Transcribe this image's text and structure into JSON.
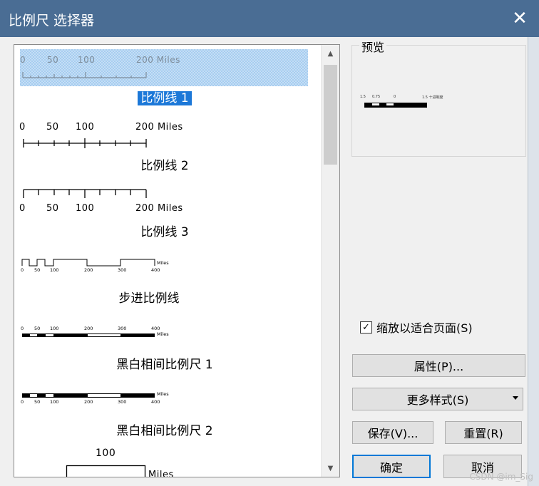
{
  "window": {
    "title": "比例尺 选择器",
    "close_glyph": "✕"
  },
  "list": {
    "items": [
      {
        "label": "比例线 1",
        "selected": true,
        "ticks": [
          "0",
          "50",
          "100",
          "200 Miles"
        ]
      },
      {
        "label": "比例线 2",
        "ticks": [
          "0",
          "50",
          "100",
          "200 Miles"
        ]
      },
      {
        "label": "比例线 3",
        "ticks": [
          "0",
          "50",
          "100",
          "200 Miles"
        ]
      },
      {
        "label": "步进比例线",
        "ticks": [
          "0",
          "50",
          "100",
          "200",
          "300",
          "400",
          "Miles"
        ]
      },
      {
        "label": "黑白相间比例尺 1",
        "ticks": [
          "0",
          "50",
          "100",
          "200",
          "300",
          "400",
          "Miles"
        ]
      },
      {
        "label": "黑白相间比例尺 2",
        "ticks": [
          "0",
          "50",
          "100",
          "200",
          "300",
          "400",
          "Miles"
        ]
      },
      {
        "label": "",
        "ticks": [
          "100",
          "Miles"
        ]
      }
    ],
    "scroll_up": "▲",
    "scroll_down": "▼"
  },
  "preview": {
    "title": "预览",
    "tiny_ticks": [
      "1.5",
      "0.75",
      "0",
      "1.5 十进制度"
    ]
  },
  "options": {
    "fit_page_label": "缩放以适合页面(S)",
    "fit_page_checked": true,
    "check_glyph": "✓"
  },
  "buttons": {
    "properties": "属性(P)...",
    "more_styles": "更多样式(S)",
    "save": "保存(V)...",
    "reset": "重置(R)",
    "ok": "确定",
    "cancel": "取消"
  },
  "watermark": "CSDN @im_Sig"
}
